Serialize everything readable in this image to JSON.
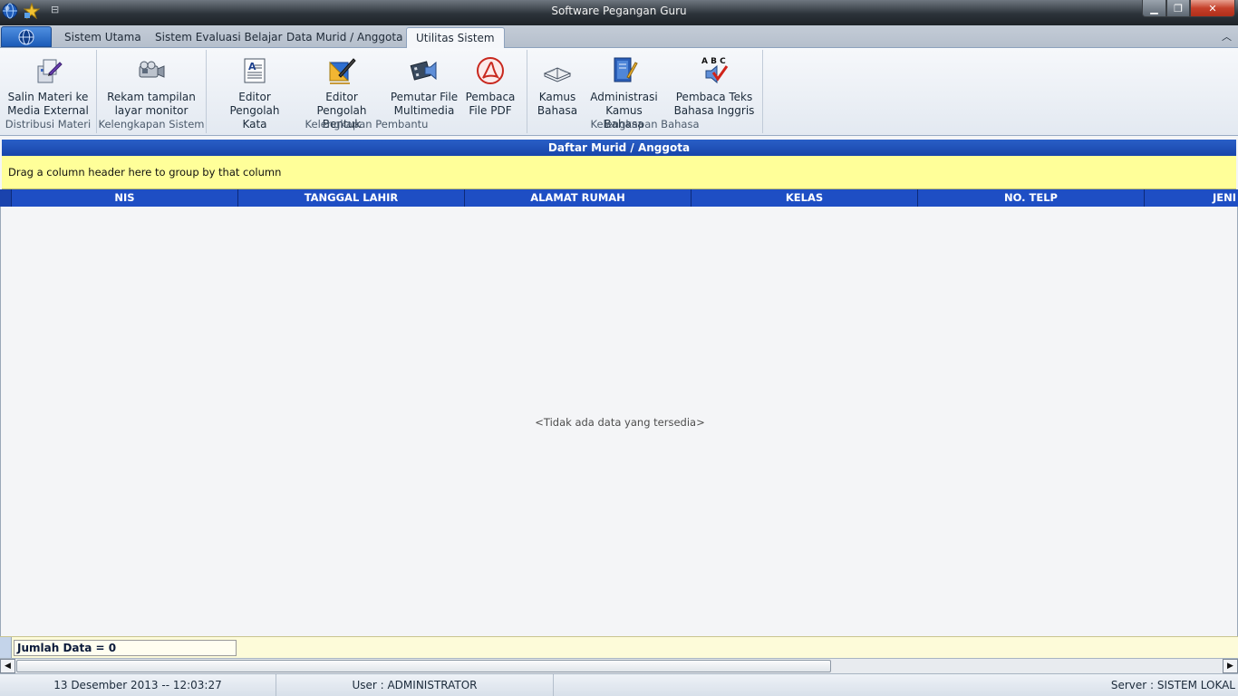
{
  "window": {
    "title": "Software Pegangan Guru"
  },
  "ribbon": {
    "tabs": [
      "Sistem Utama",
      "Sistem Evaluasi Belajar",
      "Data Murid / Anggota",
      "Utilitas Sistem"
    ],
    "active_tab": "Utilitas Sistem",
    "groups": [
      {
        "label": "Distribusi Materi",
        "buttons": [
          {
            "line1": "Salin Materi ke",
            "line2": "Media External",
            "icon": "copy-to-media-icon"
          }
        ]
      },
      {
        "label": "Kelengkapan Sistem",
        "buttons": [
          {
            "line1": "Rekam tampilan",
            "line2": "layar monitor",
            "icon": "video-camera-icon"
          }
        ]
      },
      {
        "label": "Kelengkapan Pembantu",
        "buttons": [
          {
            "line1": "Editor",
            "line2": "Pengolah Kata",
            "icon": "word-processor-icon"
          },
          {
            "line1": "Editor Pengolah",
            "line2": "Bentuk",
            "icon": "shape-editor-icon"
          },
          {
            "line1": "Pemutar File",
            "line2": "Multimedia",
            "icon": "multimedia-player-icon"
          },
          {
            "line1": "Pembaca",
            "line2": "File PDF",
            "icon": "pdf-reader-icon"
          }
        ]
      },
      {
        "label": "Kelengkapan Bahasa",
        "buttons": [
          {
            "line1": "Kamus",
            "line2": "Bahasa",
            "icon": "dictionary-icon"
          },
          {
            "line1": "Administrasi",
            "line2": "Kamus Bahasa",
            "icon": "dictionary-admin-icon"
          },
          {
            "line1": "Pembaca Teks",
            "line2": "Bahasa Inggris",
            "icon": "english-text-reader-icon"
          }
        ]
      }
    ],
    "abc_text": "A B C"
  },
  "panel": {
    "title": "Daftar Murid / Anggota",
    "group_hint": "Drag a column header here to group by that column",
    "columns": [
      "NIS",
      "TANGGAL LAHIR",
      "ALAMAT RUMAH",
      "KELAS",
      "NO. TELP",
      "JENI"
    ],
    "empty_message": "<Tidak ada data yang tersedia>",
    "count_text": "Jumlah Data = 0"
  },
  "status": {
    "datetime": "13 Desember 2013 -- 12:03:27",
    "user": "User : ADMINISTRATOR",
    "server": "Server : SISTEM LOKAL"
  },
  "colors": {
    "accent_blue": "#1e4ec4",
    "highlight_yellow": "#ffff99"
  }
}
